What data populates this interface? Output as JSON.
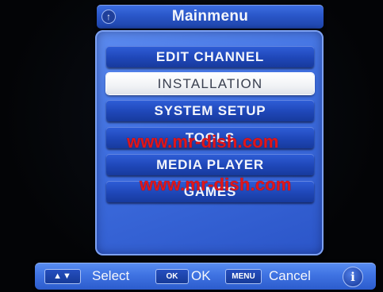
{
  "window": {
    "title": "Mainmenu",
    "back_icon": "back-icon"
  },
  "menu": {
    "items": [
      {
        "label": "EDIT CHANNEL",
        "selected": false
      },
      {
        "label": "INSTALLATION",
        "selected": true
      },
      {
        "label": "SYSTEM SETUP",
        "selected": false
      },
      {
        "label": "TOOLS",
        "selected": false
      },
      {
        "label": "MEDIA PLAYER",
        "selected": false
      },
      {
        "label": "GAMES",
        "selected": false
      }
    ]
  },
  "watermark": {
    "text": "www.mr-dish.com",
    "color": "#e0161a"
  },
  "help_bar": {
    "arrows_key": "▲▼",
    "select_label": "Select",
    "ok_key": "OK",
    "ok_label": "OK",
    "menu_key": "MENU",
    "cancel_label": "Cancel",
    "info_icon": "i"
  },
  "colors": {
    "panel_blue": "#3f6fe0",
    "item_blue": "#1f47b8",
    "selected_bg": "#ffffff",
    "selected_text": "#3a4050",
    "text": "#f3f5fb"
  }
}
